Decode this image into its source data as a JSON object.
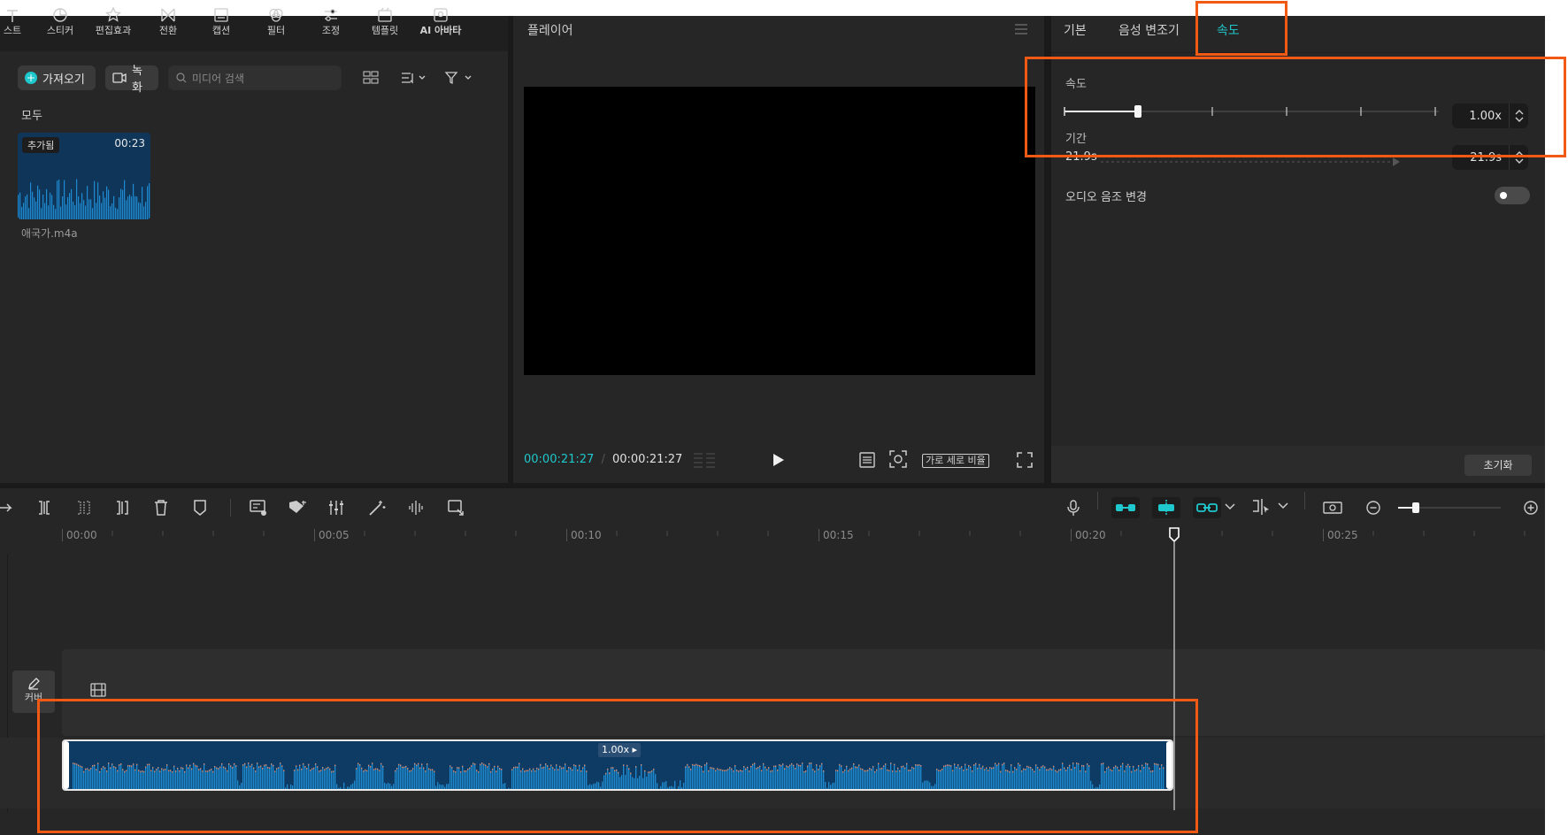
{
  "toolbar_tabs": [
    {
      "label": "스트",
      "icon": "text-icon"
    },
    {
      "label": "스티커",
      "icon": "sticker-icon"
    },
    {
      "label": "편집효과",
      "icon": "effects-icon"
    },
    {
      "label": "전환",
      "icon": "transition-icon"
    },
    {
      "label": "캡션",
      "icon": "caption-icon"
    },
    {
      "label": "필터",
      "icon": "filter-icon"
    },
    {
      "label": "조정",
      "icon": "adjust-icon"
    },
    {
      "label": "템플릿",
      "icon": "template-icon"
    },
    {
      "label": "AI 아바타",
      "icon": "ai-avatar-icon"
    }
  ],
  "media": {
    "import_label": "가져오기",
    "record_label": "녹화",
    "search_placeholder": "미디어 검색",
    "category": "모두",
    "item": {
      "badge": "추가됨",
      "duration": "00:23",
      "name": "애국가.m4a"
    }
  },
  "player": {
    "title": "플레이어",
    "current_time": "00:00:21:27",
    "separator": "/",
    "total_time": "00:00:21:27",
    "ratio_label": "가로 세로 비율"
  },
  "inspector": {
    "tabs": [
      {
        "label": "기본",
        "active": false
      },
      {
        "label": "음성 변조기",
        "active": false
      },
      {
        "label": "속도",
        "active": true
      }
    ],
    "speed_label": "속도",
    "speed_value": "1.00x",
    "speed_level": 0.2,
    "duration_label": "기간",
    "duration_from": "21.9s",
    "duration_value": "21.9s",
    "pitch_label": "오디오 음조 변경",
    "pitch_on": false,
    "reset_label": "초기화"
  },
  "timeline": {
    "ruler": [
      "00:00",
      "00:05",
      "00:10",
      "00:15",
      "00:20",
      "00:25"
    ],
    "cover_label": "커버",
    "clip_speed_label": "1.00x",
    "playhead_time_sec": 21.9,
    "zoom_level": 0.18
  },
  "colors": {
    "accent": "#1ec8cc",
    "highlight": "#f05a14",
    "clip": "#0e3b63",
    "wave": "#1e8bd0"
  }
}
